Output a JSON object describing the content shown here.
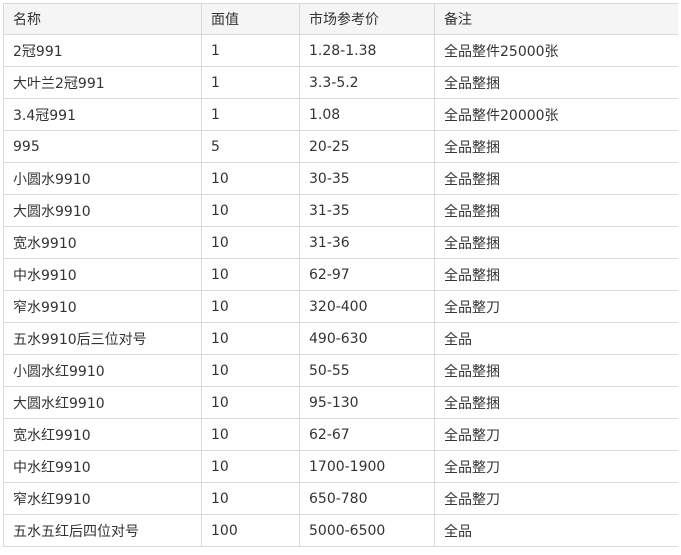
{
  "table": {
    "headers": [
      "名称",
      "面值",
      "市场参考价",
      "备注"
    ],
    "rows": [
      [
        "2冠991",
        "1",
        "1.28-1.38",
        "全品整件25000张"
      ],
      [
        "大叶兰2冠991",
        "1",
        "3.3-5.2",
        "全品整捆"
      ],
      [
        "3.4冠991",
        "1",
        "1.08",
        "全品整件20000张"
      ],
      [
        "995",
        "5",
        "20-25",
        "全品整捆"
      ],
      [
        "小圆水9910",
        "10",
        "30-35",
        "全品整捆"
      ],
      [
        "大圆水9910",
        "10",
        "31-35",
        "全品整捆"
      ],
      [
        "宽水9910",
        "10",
        "31-36",
        "全品整捆"
      ],
      [
        "中水9910",
        "10",
        "62-97",
        "全品整捆"
      ],
      [
        "窄水9910",
        "10",
        "320-400",
        "全品整刀"
      ],
      [
        "五水9910后三位对号",
        "10",
        "490-630",
        "全品"
      ],
      [
        "小圆水红9910",
        "10",
        "50-55",
        "全品整捆"
      ],
      [
        "大圆水红9910",
        "10",
        "95-130",
        "全品整捆"
      ],
      [
        "宽水红9910",
        "10",
        "62-67",
        "全品整刀"
      ],
      [
        "中水红9910",
        "10",
        "1700-1900",
        "全品整刀"
      ],
      [
        "窄水红9910",
        "10",
        "650-780",
        "全品整刀"
      ],
      [
        "五水五红后四位对号",
        "100",
        "5000-6500",
        "全品"
      ]
    ]
  }
}
